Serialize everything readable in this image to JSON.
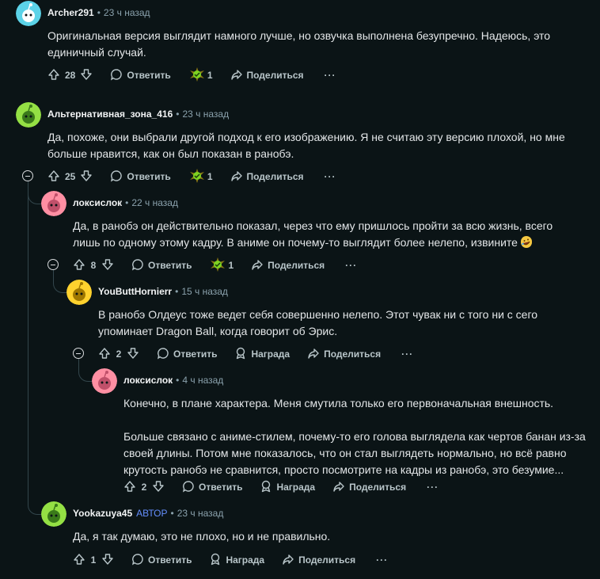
{
  "labels": {
    "reply": "Ответить",
    "share": "Поделиться",
    "award": "Награда",
    "more": "···",
    "dot": "•"
  },
  "comments": [
    {
      "author": "Archer291",
      "time": "23 ч назад",
      "avatar_color": "#5cd3e8",
      "body": [
        "Оригинальная версия выглядит намного лучше, но озвучка выполнена безупречно. Надеюсь, это единичный случай."
      ],
      "votes": "28",
      "award_count": "1"
    },
    {
      "author": "Альтернативная_зона_416",
      "time": "23 ч назад",
      "avatar_color": "#94e044",
      "body": [
        "Да, похоже, они выбрали другой подход к его изображению. Я не считаю эту версию плохой, но мне больше нравится, как он был показан в ранобэ."
      ],
      "votes": "25",
      "award_count": "1"
    },
    {
      "author": "локсислок",
      "time": "22 ч назад",
      "avatar_color": "#ff8fa3",
      "body": [
        "Да, в ранобэ он действительно показал, через что ему пришлось пройти за всю жизнь, всего лишь по одному этому кадру. В аниме он почему-то выглядит более нелепо, извините"
      ],
      "emoji": "rolling-laughing-emoji",
      "votes": "8",
      "award_count": "1"
    },
    {
      "author": "YouButtHornierr",
      "time": "15 ч назад",
      "avatar_color": "#ffd22e",
      "body": [
        "В ранобэ Олдеус тоже ведет себя совершенно нелепо. Этот чувак ни с того ни с сего упоминает Dragon Ball, когда говорит об Эрис."
      ],
      "votes": "2"
    },
    {
      "author": "локсислок",
      "time": "4 ч назад",
      "avatar_color": "#ff8fa3",
      "body": [
        "Конечно, в плане характера. Меня смутила только его первоначальная внешность.",
        "Больше связано с аниме-стилем, почему-то его голова выглядела как чертов банан из-за своей длины. Потом мне показалось, что он стал выглядеть нормально, но всё равно крутость ранобэ не сравнится, просто посмотрите на кадры из ранобэ, это безумие..."
      ],
      "votes": "2"
    },
    {
      "author": "Yookazuya45",
      "op_badge": "АВТОР",
      "time": "23 ч назад",
      "avatar_color": "#94e044",
      "body": [
        "Да, я так думаю, это не плохо, но и не правильно."
      ],
      "votes": "1"
    }
  ]
}
